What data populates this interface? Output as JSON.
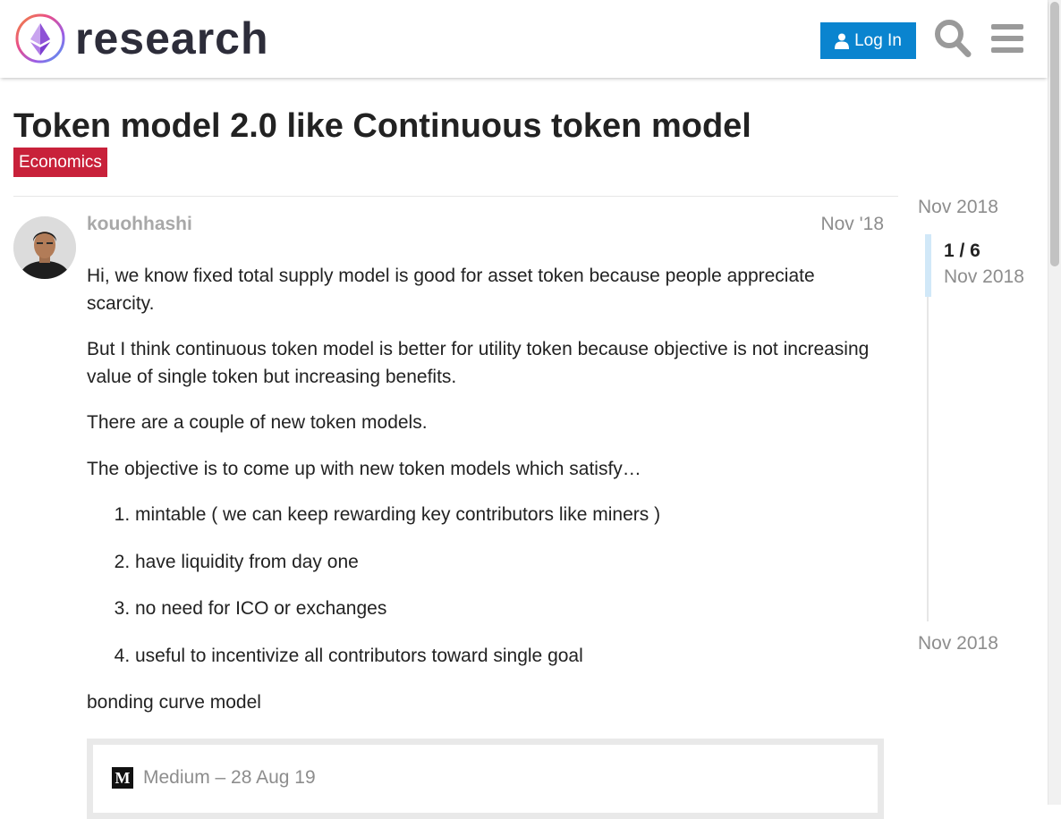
{
  "header": {
    "site_name": "research",
    "login_label": "Log In",
    "brand_color": "#0a84cf"
  },
  "topic": {
    "title": "Token model 2.0 like Continuous token model",
    "category": "Economics",
    "category_color": "#c8213a"
  },
  "post": {
    "author": "kouohhashi",
    "date": "Nov '18",
    "paragraphs": [
      "Hi, we know fixed total supply model is good for asset token because people appreciate scarcity.",
      "But I think continuous token model is better for utility token because objective is not increasing value of single token but increasing benefits.",
      "There are a couple of new token models.",
      "The objective is to come up with new token models which satisfy…"
    ],
    "list_items": [
      "mintable ( we can keep rewarding key contributors like miners )",
      "have liquidity from day one",
      "no need for ICO or exchanges",
      "useful to incentivize all contributors toward single goal"
    ],
    "closing_paragraph": "bonding curve model",
    "onebox": {
      "icon_letter": "M",
      "source": "Medium – 28 Aug 19"
    }
  },
  "timeline": {
    "start_date": "Nov 2018",
    "position": "1 / 6",
    "position_date": "Nov 2018",
    "end_date": "Nov 2018"
  }
}
